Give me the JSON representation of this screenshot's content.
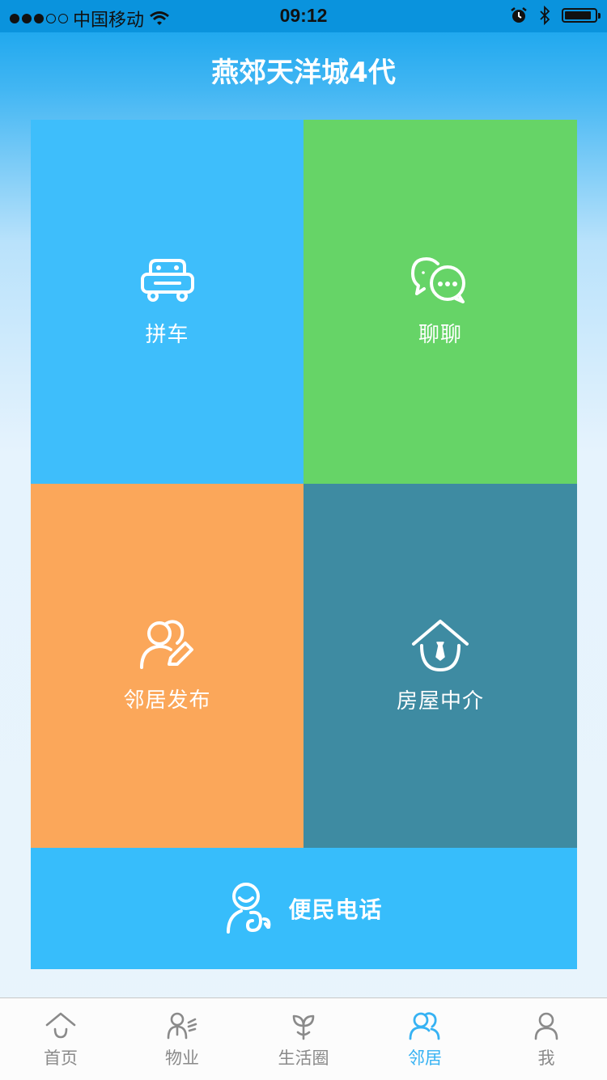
{
  "status_bar": {
    "carrier": "中国移动",
    "time": "09:12",
    "signal_bars_filled": 3,
    "signal_bars_total": 5,
    "battery_level": 0.9,
    "icons": [
      "signal-dots-icon",
      "wifi-icon",
      "alarm-icon",
      "bluetooth-icon",
      "battery-icon"
    ]
  },
  "header": {
    "title": "燕郊天洋城4代"
  },
  "tiles": {
    "carpool": {
      "label": "拼车",
      "icon": "car-icon",
      "color": "#3ebefb"
    },
    "chat": {
      "label": "聊聊",
      "icon": "chat-bubbles-icon",
      "color": "#66d467"
    },
    "neighbor_post": {
      "label": "邻居发布",
      "icon": "people-edit-icon",
      "color": "#fba75a"
    },
    "housing_agent": {
      "label": "房屋中介",
      "icon": "house-agent-icon",
      "color": "#3e8ba2"
    },
    "public_phone": {
      "label": "便民电话",
      "icon": "phone-person-icon",
      "color": "#37bdfb"
    }
  },
  "tabbar": {
    "active_color": "#36b2f3",
    "inactive_color": "#8a8a8a",
    "items": [
      {
        "label": "首页",
        "icon": "home-icon",
        "active": false
      },
      {
        "label": "物业",
        "icon": "property-staff-icon",
        "active": false
      },
      {
        "label": "生活圈",
        "icon": "sprout-icon",
        "active": false
      },
      {
        "label": "邻居",
        "icon": "neighbors-icon",
        "active": true
      },
      {
        "label": "我",
        "icon": "user-icon",
        "active": false
      }
    ]
  }
}
